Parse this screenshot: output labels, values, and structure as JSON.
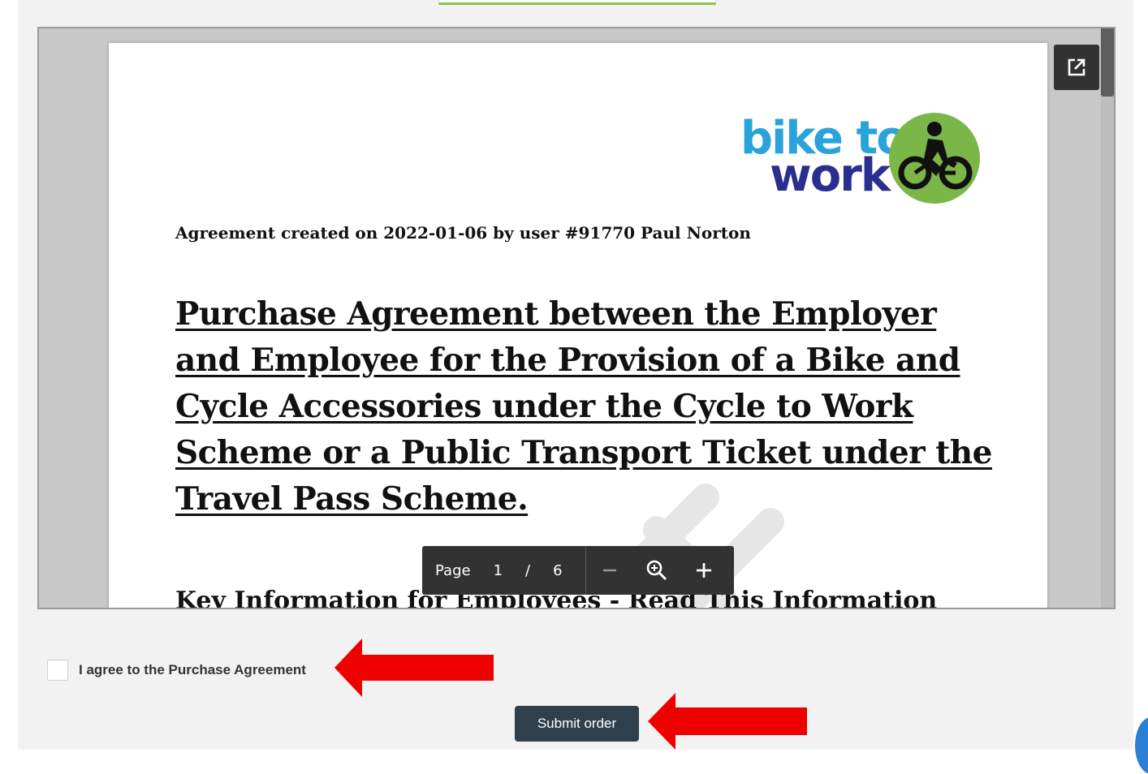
{
  "document": {
    "created_line": "Agreement created on 2022-01-06 by user #91770 Paul Norton",
    "title": "Purchase Agreement between the Employer and Employee for the Provision of a Bike and Cycle Accessories under the Cycle to Work Scheme or a Public Transport Ticket under the Travel Pass Scheme.",
    "subheading": "Key Information for Employees - Read This Information",
    "logo": {
      "line1": "bike to",
      "line2": "work",
      "icon": "cyclist-icon"
    }
  },
  "viewer": {
    "page_label": "Page",
    "current_page": "1",
    "separator": "/",
    "total_pages": "6",
    "popout_icon": "open-in-new-icon",
    "zoom_out_icon": "minus-icon",
    "zoom_icon": "magnifier-icon",
    "zoom_in_icon": "plus-icon"
  },
  "form": {
    "agree_label": "I agree to the Purchase Agreement",
    "agree_checked": false,
    "submit_label": "Submit order"
  },
  "colors": {
    "logo_blue": "#29a3d9",
    "logo_navy": "#2a2f8f",
    "logo_green": "#7ab648",
    "toolbar": "#323232",
    "submit_bg": "#2f3f4c",
    "annotation_arrow": "#ee0000"
  }
}
